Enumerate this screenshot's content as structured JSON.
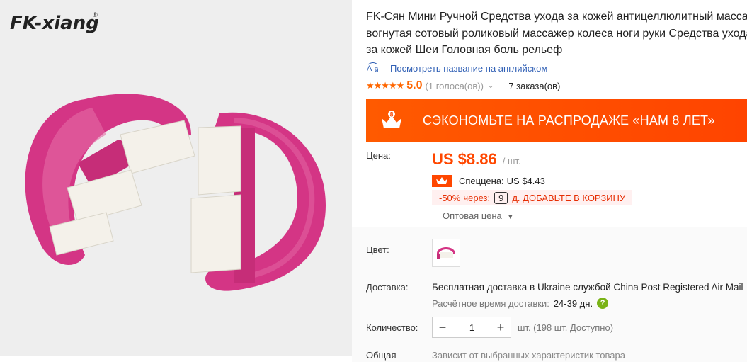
{
  "gallery": {
    "logo_text": "FK-xiang",
    "logo_mark": "®"
  },
  "product": {
    "title_lines": [
      "FK-Сян Мини Ручной Средства ухода за кожей антицеллюлитный массаж",
      "вогнутая сотовый роликовый массажер колеса ноги руки Средства ухода",
      "за кожей Шеи Головная боль рельеф"
    ],
    "translate_link": "Посмотреть название на английском",
    "translate_icon": "translate-icon",
    "rating": {
      "stars": "★★★★★",
      "value": "5.0",
      "votes": "(1 голоса(ов))",
      "orders": "7 заказа(ов)"
    },
    "promo": {
      "text": "СЭКОНОМЬТЕ НА РАСПРОДАЖЕ «НАМ 8 ЛЕТ»",
      "badge": "8",
      "color": "#ff4700"
    },
    "price": {
      "label": "Цена:",
      "value": "US $8.86",
      "unit": "/ шт."
    },
    "special": {
      "label": "Спеццена:",
      "value": "US $4.43"
    },
    "discount": {
      "pct": "-50%",
      "through": "через:",
      "days": "9",
      "action": "д. ДОБАВЬТЕ В КОРЗИНУ"
    },
    "wholesale": "Оптовая цена",
    "color_label": "Цвет:",
    "shipping": {
      "label": "Доставка:",
      "line": "Бесплатная доставка в Ukraine службой China Post Registered Air Mail",
      "eta_label": "Расчётное время доставки:",
      "eta_value": "24-39 дн."
    },
    "quantity": {
      "label": "Количество:",
      "value": "1",
      "minus": "−",
      "plus": "+",
      "note": "шт. (198 шт. Доступно)"
    },
    "total": {
      "label": "Общая",
      "note": "Зависит от выбранных характеристик товара"
    }
  }
}
